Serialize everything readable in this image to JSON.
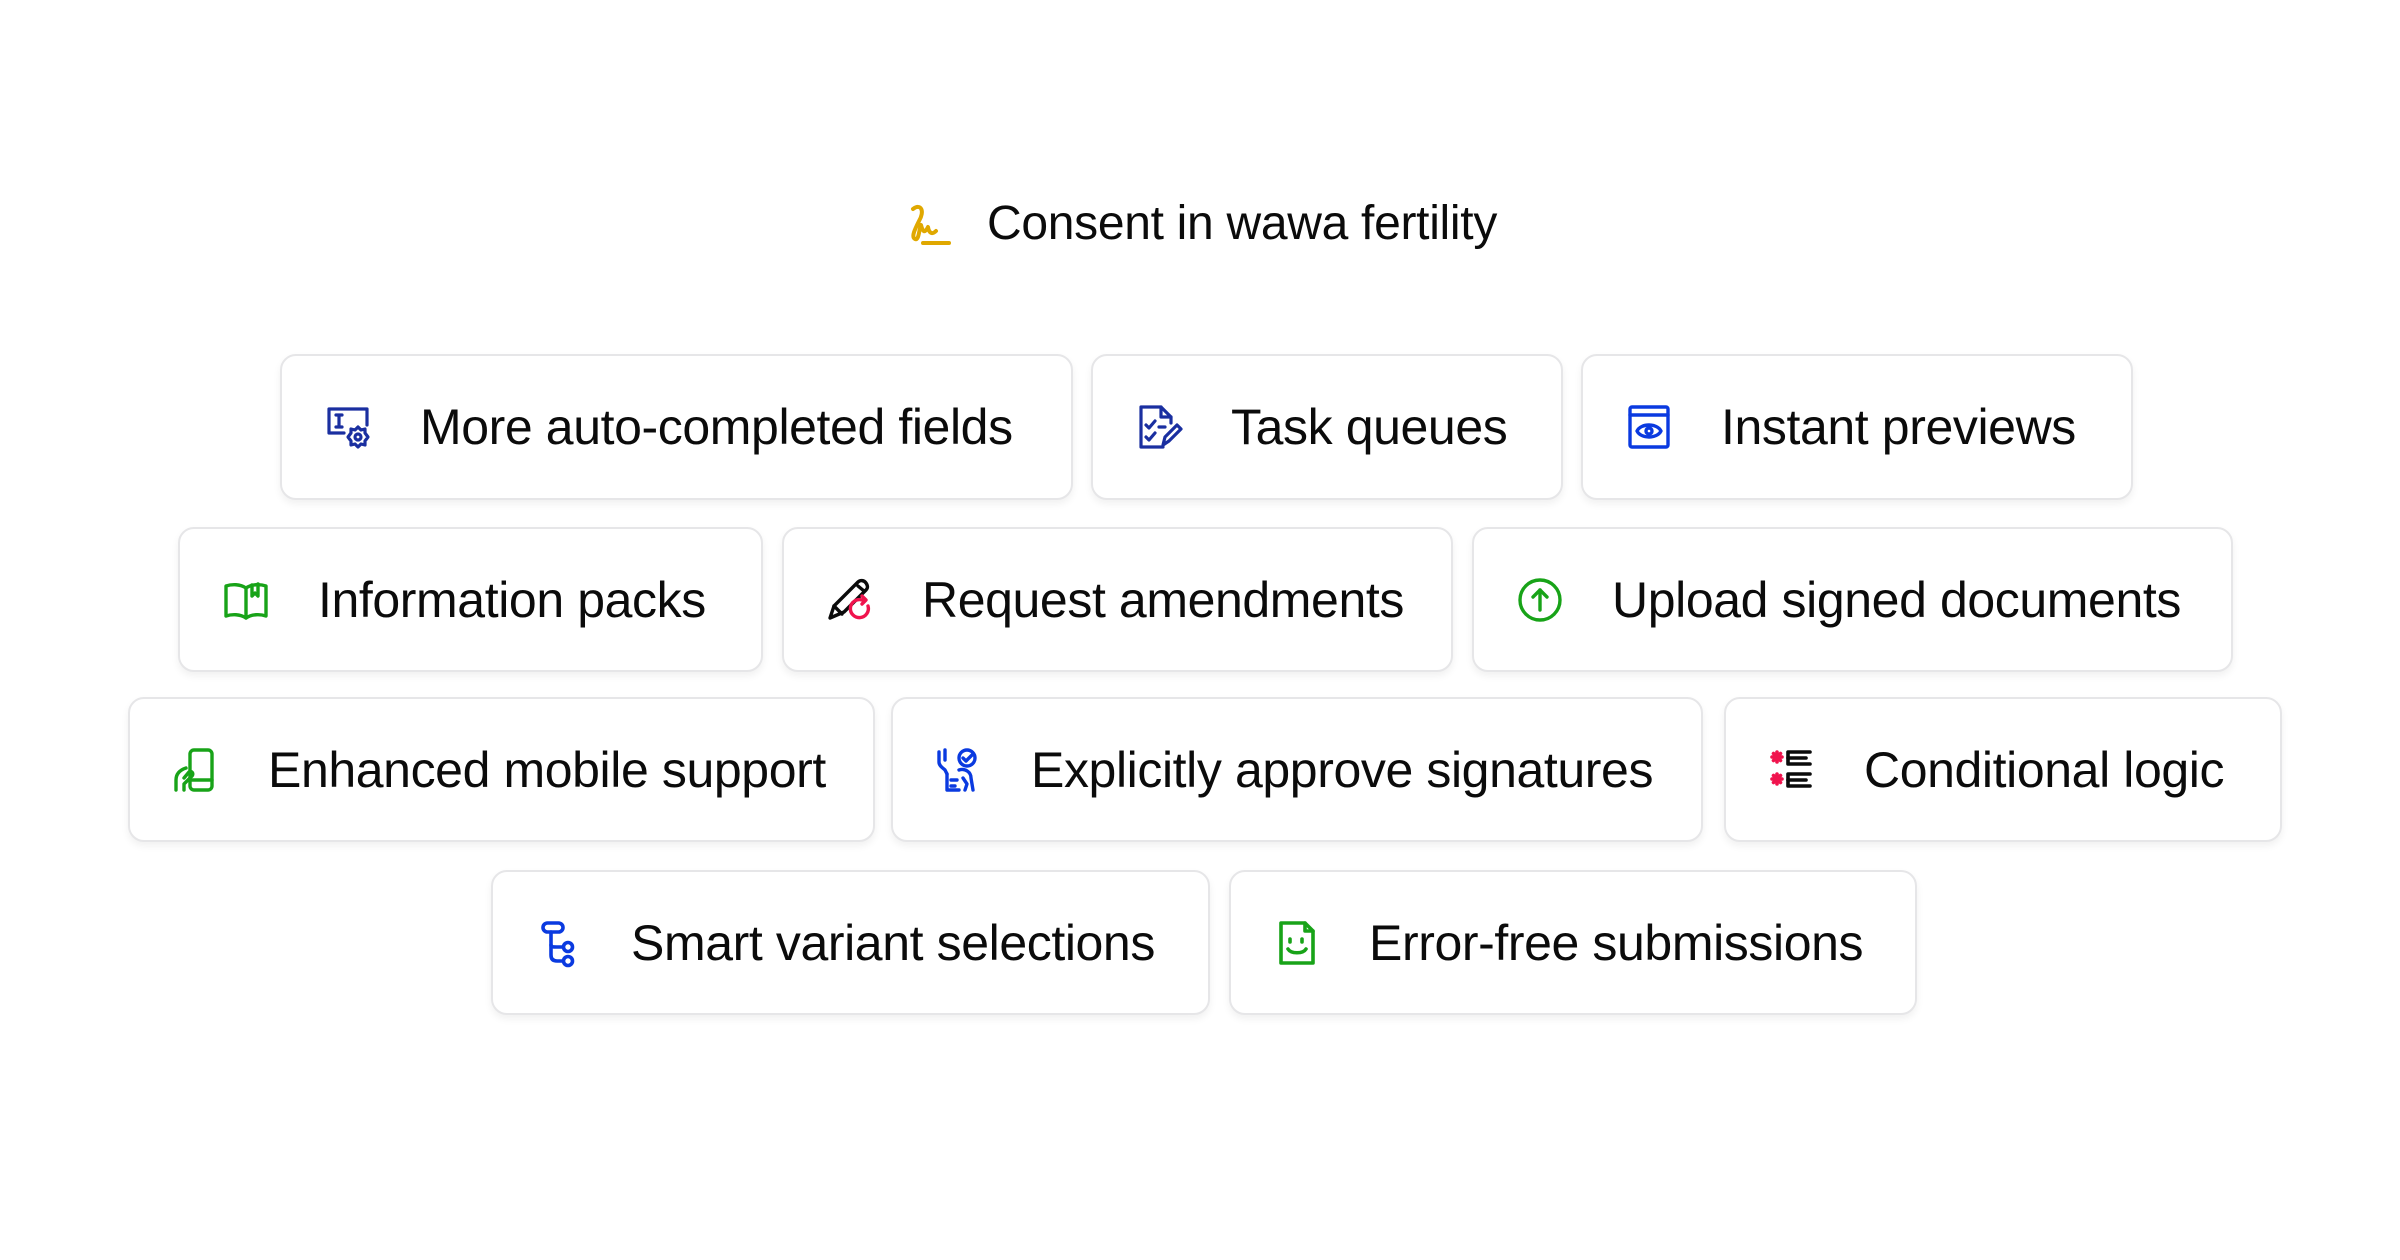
{
  "header": {
    "title": "Consent in wawa fertility",
    "icon": "signature-icon",
    "icon_color": "#e0a800"
  },
  "colors": {
    "navy": "#1a2fa0",
    "blue": "#0a3ae0",
    "green": "#18a318",
    "red": "#f0134d",
    "black": "#0b0b0b",
    "card_border": "#e6e6e8"
  },
  "features": [
    {
      "label": "More auto-completed fields",
      "icon": "text-field-gear-icon"
    },
    {
      "label": "Task queues",
      "icon": "checklist-pencil-icon"
    },
    {
      "label": "Instant previews",
      "icon": "window-eye-icon"
    },
    {
      "label": "Information packs",
      "icon": "open-book-icon"
    },
    {
      "label": "Request amendments",
      "icon": "pencil-refresh-icon"
    },
    {
      "label": "Upload signed documents",
      "icon": "upload-circle-icon"
    },
    {
      "label": "Enhanced mobile support",
      "icon": "hand-phone-icon"
    },
    {
      "label": "Explicitly approve signatures",
      "icon": "person-approve-icon"
    },
    {
      "label": "Conditional logic",
      "icon": "conditional-list-icon"
    },
    {
      "label": "Smart variant selections",
      "icon": "branch-tree-icon"
    },
    {
      "label": "Error-free submissions",
      "icon": "smiley-document-icon"
    }
  ]
}
